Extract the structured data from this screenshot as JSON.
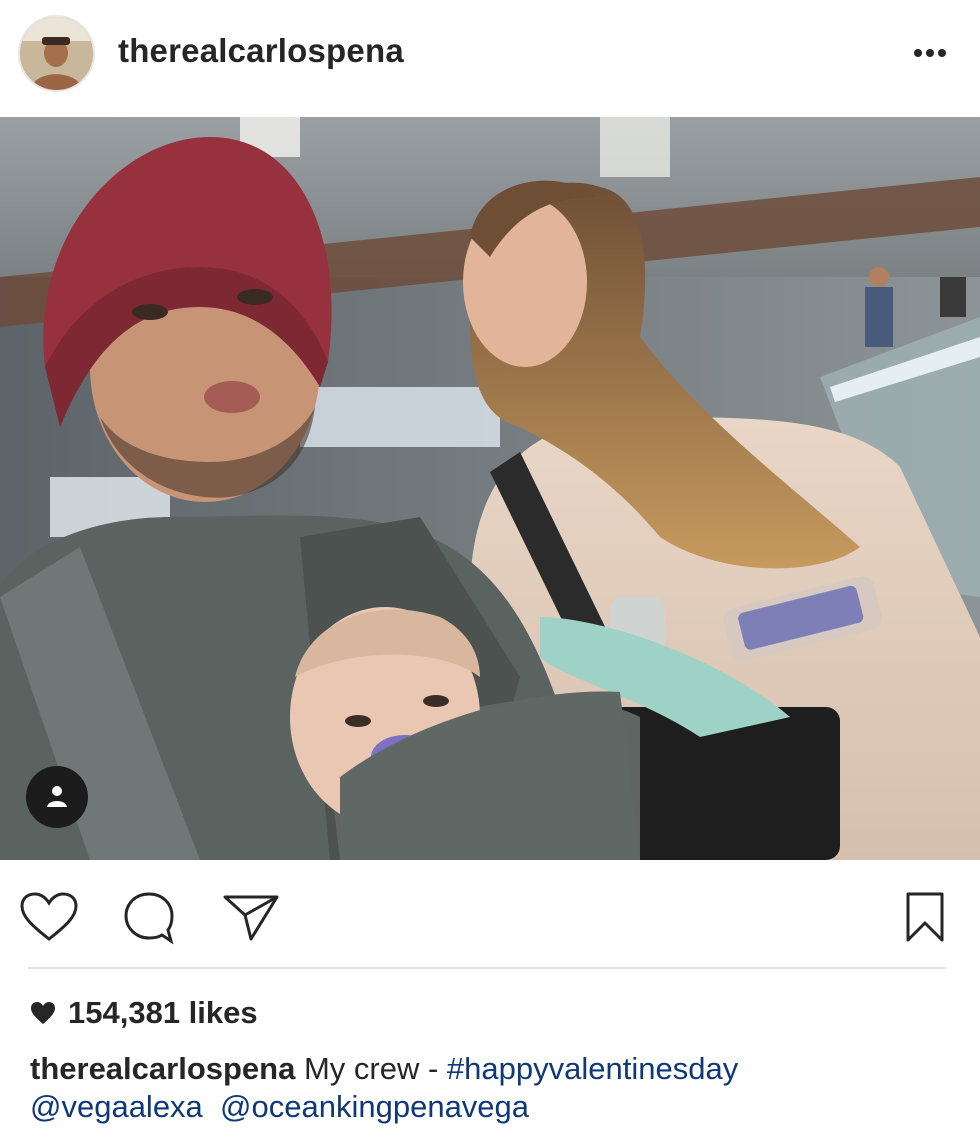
{
  "post": {
    "username": "therealcarlospena",
    "more_icon": "more-horizontal-icon",
    "likes_count": "154,381 likes",
    "caption": {
      "username": "therealcarlospena",
      "text": "My crew - ",
      "hashtag": "#happyvalentinesday",
      "mention_1": "@vegaalexa",
      "mention_2": "@oceankingpenavega"
    }
  },
  "icons": {
    "like": "heart-outline-icon",
    "comment": "comment-bubble-icon",
    "share": "paper-plane-icon",
    "save": "bookmark-icon",
    "tagged_people": "person-icon",
    "likes_heart": "heart-filled-icon"
  },
  "colors": {
    "text": "#262626",
    "link": "#0f3878",
    "divider": "#e3e3e3"
  }
}
